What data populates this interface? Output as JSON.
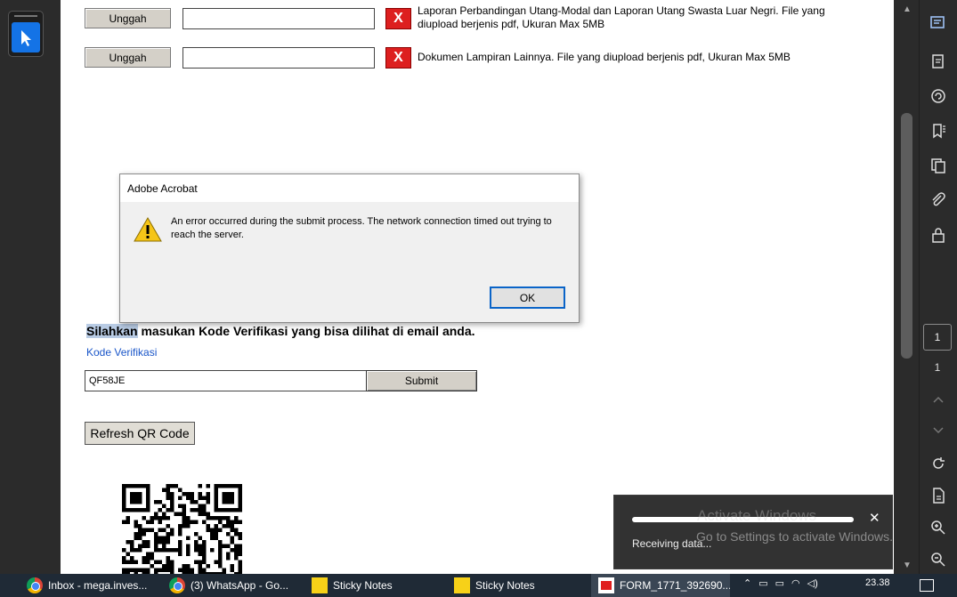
{
  "form": {
    "rows": [
      {
        "button": "Unggah",
        "value": "",
        "remove": "X",
        "description": "Laporan Perbandingan Utang-Modal dan Laporan Utang Swasta Luar Negri. File yang diupload berjenis pdf, Ukuran Max 5MB"
      },
      {
        "button": "Unggah",
        "value": "",
        "remove": "X",
        "description": "Dokumen Lampiran Lainnya. File yang diupload berjenis pdf, Ukuran Max 5MB"
      }
    ],
    "verification": {
      "heading_highlight": "Silahkan",
      "heading_rest": " masukan Kode Verifikasi yang bisa dilihat di email anda.",
      "label": "Kode Verifikasi",
      "code_value": "QF58JE",
      "submit_label": "Submit"
    },
    "refresh_label": "Refresh QR Code"
  },
  "dialog": {
    "title": "Adobe Acrobat",
    "message": "An error occurred during the submit process. The network connection timed out trying to reach the server.",
    "ok_label": "OK",
    "icon": "warning-icon"
  },
  "toast": {
    "text": "Receiving data...",
    "close": "✕",
    "progress": 1.0
  },
  "watermark": {
    "title": "Activate Windows",
    "subtitle": "Go to Settings to activate Windows."
  },
  "sidebar_right": {
    "page_current": "1",
    "page_total": "1",
    "tools": [
      "comment-icon",
      "organize-pages-icon",
      "export-pdf-icon",
      "bookmark-icon",
      "copy-pages-icon",
      "attachment-icon",
      "lock-icon",
      "rotate-icon",
      "page-size-icon",
      "zoom-in-icon",
      "zoom-out-icon"
    ]
  },
  "taskbar": {
    "items": [
      {
        "label": "Inbox - mega.inves...",
        "icon": "chrome-icon"
      },
      {
        "label": "(3) WhatsApp - Go...",
        "icon": "chrome-icon"
      },
      {
        "label": "Sticky Notes",
        "icon": "sticky-notes-icon"
      },
      {
        "label": "Sticky Notes",
        "icon": "sticky-notes-icon"
      },
      {
        "label": "FORM_1771_392690...",
        "icon": "pdf-icon"
      }
    ],
    "clock": "23.38"
  },
  "colors": {
    "acrobat_blue": "#1473e6",
    "error_red": "#dd1f1f",
    "link_blue": "#1a56c9",
    "highlight": "#b8cbe4"
  }
}
